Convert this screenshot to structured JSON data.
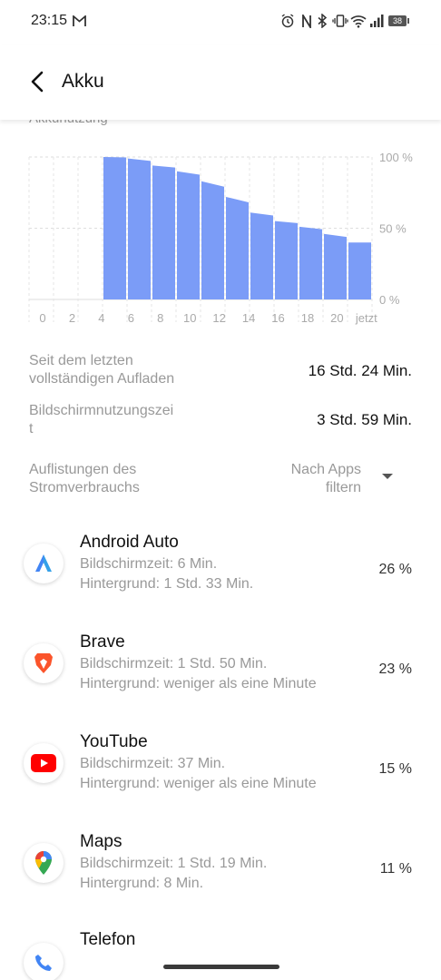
{
  "status": {
    "time": "23:15",
    "battery_level": "38"
  },
  "header": {
    "title": "Akku",
    "section_label": "Akkunutzung"
  },
  "chart_data": {
    "type": "area",
    "x_ticks": [
      "0",
      "2",
      "4",
      "6",
      "8",
      "10",
      "12",
      "14",
      "16",
      "18",
      "20",
      "jetzt"
    ],
    "y_ticks": [
      "100 %",
      "50 %",
      "0 %"
    ],
    "ylim": [
      0,
      100
    ],
    "bar_color": "#7b9cf7",
    "values": [
      null,
      null,
      null,
      100,
      99,
      94,
      90,
      83,
      72,
      61,
      55,
      51,
      46,
      40
    ]
  },
  "summary": [
    {
      "label": "Seit dem letzten\nvollständigen Aufladen",
      "value": "16 Std. 24 Min."
    },
    {
      "label": "Bildschirmnutzungszei\nt",
      "value": "3 Std. 59 Min."
    }
  ],
  "usage_header": {
    "label": "Auflistungen des\nStromverbrauchs",
    "filter": "Nach Apps\nfiltern"
  },
  "apps": [
    {
      "name": "Android Auto",
      "screen": "Bildschirmzeit: 6 Min.",
      "background": "Hintergrund: 1 Std. 33 Min.",
      "percent": "26 %",
      "icon": "android-auto-icon"
    },
    {
      "name": "Brave",
      "screen": "Bildschirmzeit: 1 Std. 50 Min.",
      "background": "Hintergrund: weniger als eine Minute",
      "percent": "23 %",
      "icon": "brave-icon"
    },
    {
      "name": "YouTube",
      "screen": "Bildschirmzeit: 37 Min.",
      "background": "Hintergrund: weniger als eine Minute",
      "percent": "15 %",
      "icon": "youtube-icon"
    },
    {
      "name": "Maps",
      "screen": "Bildschirmzeit: 1 Std. 19 Min.",
      "background": "Hintergrund: 8 Min.",
      "percent": "11 %",
      "icon": "maps-icon"
    },
    {
      "name": "Telefon",
      "icon": "phone-icon"
    }
  ]
}
